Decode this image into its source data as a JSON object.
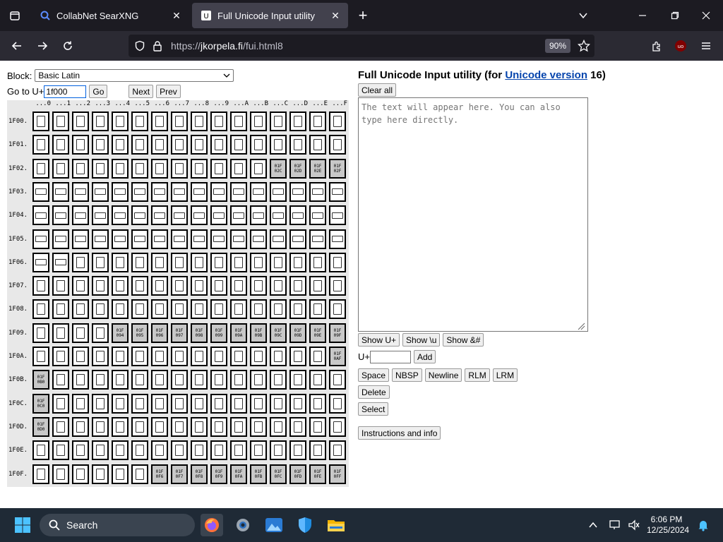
{
  "browser": {
    "tabs": [
      {
        "title": "CollabNet SearXNG",
        "icon": "search-icon",
        "active": false
      },
      {
        "title": "Full Unicode Input utility",
        "icon": "unicode-favicon",
        "active": true
      }
    ],
    "url_scheme": "https://",
    "url_host": "jkorpela.fi",
    "url_path": "/fui.html8",
    "zoom": "90%"
  },
  "left_panel": {
    "block_label": "Block:",
    "block_value": "Basic Latin",
    "goto_label": "Go to U+",
    "goto_value": "1f000",
    "go_label": "Go",
    "next_label": "Next",
    "prev_label": "Prev"
  },
  "grid": {
    "col_headers": [
      "...0",
      "...1",
      "...2",
      "...3",
      "...4",
      "...5",
      "...6",
      "...7",
      "...8",
      "...9",
      "...A",
      "...B",
      "...C",
      "...D",
      "...E",
      "...F"
    ],
    "rows": [
      {
        "label": "1F00.",
        "gray": []
      },
      {
        "label": "1F01.",
        "gray": []
      },
      {
        "label": "1F02.",
        "gray": [
          12,
          13,
          14,
          15
        ]
      },
      {
        "label": "1F03.",
        "gray": []
      },
      {
        "label": "1F04.",
        "gray": []
      },
      {
        "label": "1F05.",
        "gray": []
      },
      {
        "label": "1F06.",
        "gray": []
      },
      {
        "label": "1F07.",
        "gray": []
      },
      {
        "label": "1F08.",
        "gray": []
      },
      {
        "label": "1F09.",
        "gray": [
          4,
          5,
          6,
          7,
          8,
          9,
          10,
          11,
          12,
          13,
          14,
          15
        ]
      },
      {
        "label": "1F0A.",
        "gray": [
          15
        ]
      },
      {
        "label": "1F0B.",
        "gray": [
          0
        ]
      },
      {
        "label": "1F0C.",
        "gray": [
          0
        ]
      },
      {
        "label": "1F0D.",
        "gray": [
          0
        ]
      },
      {
        "label": "1F0E.",
        "gray": []
      },
      {
        "label": "1F0F.",
        "gray": [
          6,
          7,
          8,
          9,
          10,
          11,
          12,
          13,
          14,
          15
        ]
      }
    ],
    "gray_codes": {
      "1F02": [
        "01F\n02C",
        "01F\n02D",
        "01F\n02E",
        "01F\n02F"
      ],
      "1F09": [
        "01F\n094",
        "01F\n095",
        "01F\n096",
        "01F\n097",
        "01F\n098",
        "01F\n099",
        "01F\n09A",
        "01F\n09B",
        "01F\n09C",
        "01F\n09D",
        "01F\n09E",
        "01F\n09F"
      ],
      "1F0A": [
        "01F\n0AF"
      ],
      "1F0B": [
        "01F\n0B0"
      ],
      "1F0C": [
        "01F\n0C0"
      ],
      "1F0D": [
        "01F\n0D0"
      ],
      "1F0F": [
        "01F\n0F6",
        "01F\n0F7",
        "01F\n0F8",
        "01F\n0F9",
        "01F\n0FA",
        "01F\n0FB",
        "01F\n0FC",
        "01F\n0FD",
        "01F\n0FE",
        "01F\n0FF"
      ]
    }
  },
  "right_panel": {
    "title_prefix": "Full Unicode Input utility (for ",
    "title_link": "Unicode version",
    "title_suffix": " 16)",
    "clear_label": "Clear all",
    "textarea_placeholder": "The text will appear here. You can also type here directly.",
    "show_uplus": "Show U+",
    "show_u": "Show \\u",
    "show_amp": "Show &#",
    "uplus_label": "U+",
    "add_label": "Add",
    "space_label": "Space",
    "nbsp_label": "NBSP",
    "newline_label": "Newline",
    "rlm_label": "RLM",
    "lrm_label": "LRM",
    "delete_label": "Delete",
    "select_label": "Select",
    "instructions_label": "Instructions and info"
  },
  "taskbar": {
    "search_label": "Search",
    "time": "6:06 PM",
    "date": "12/25/2024"
  }
}
